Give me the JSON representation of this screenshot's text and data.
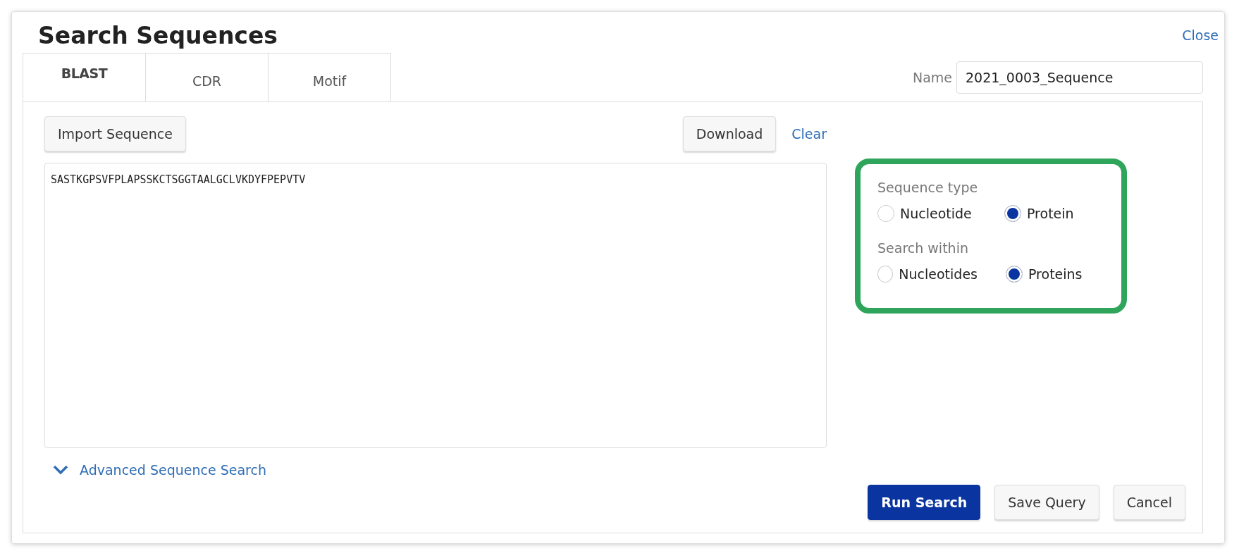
{
  "dialog": {
    "title": "Search Sequences",
    "close_link": "Close"
  },
  "tabs": [
    {
      "label": "BLAST",
      "selected": true
    },
    {
      "label": "CDR",
      "selected": false
    },
    {
      "label": "Motif",
      "selected": false
    }
  ],
  "name_field": {
    "label": "Name",
    "value": "2021_0003_Sequence"
  },
  "toolbar": {
    "import_button": "Import Sequence",
    "download_button": "Download",
    "clear_link": "Clear"
  },
  "sequence_field": {
    "value": "SASTKGPSVFPLAPSSKCTSGGTAALGCLVKDYFPEPVTV"
  },
  "options_panel": {
    "highlighted": true,
    "groups": [
      {
        "label": "Sequence type",
        "options": [
          {
            "label": "Nucleotide",
            "selected": false
          },
          {
            "label": "Protein",
            "selected": true
          }
        ]
      },
      {
        "label": "Search within",
        "options": [
          {
            "label": "Nucleotides",
            "selected": false
          },
          {
            "label": "Proteins",
            "selected": true
          }
        ]
      }
    ]
  },
  "advanced_link": {
    "label": "Advanced Sequence Search",
    "expanded": false
  },
  "buttons": [
    {
      "label": "Run Search",
      "kind": "primary"
    },
    {
      "label": "Save Query",
      "kind": "secondary"
    },
    {
      "label": "Cancel",
      "kind": "secondary"
    }
  ]
}
